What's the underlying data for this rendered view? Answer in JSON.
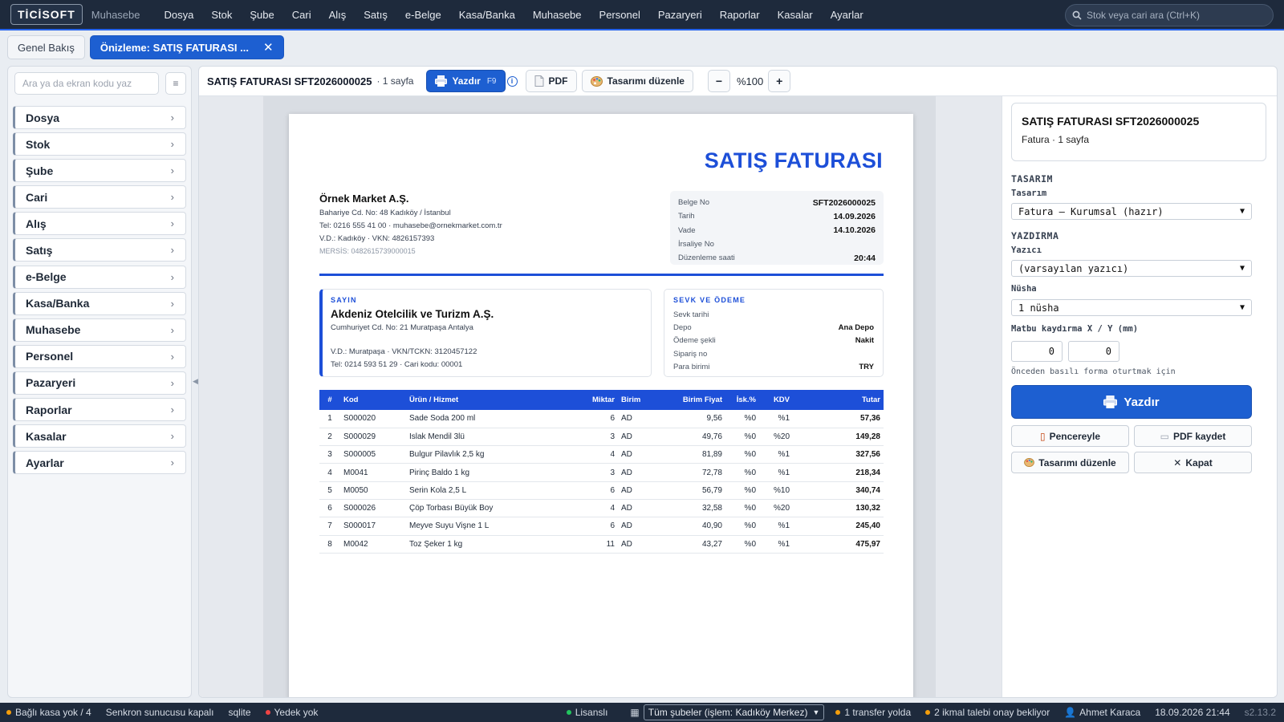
{
  "app": {
    "logo": "TİCİSOFT",
    "module": "Muhasebe"
  },
  "menu": [
    "Dosya",
    "Stok",
    "Şube",
    "Cari",
    "Alış",
    "Satış",
    "e-Belge",
    "Kasa/Banka",
    "Muhasebe",
    "Personel",
    "Pazaryeri",
    "Raporlar",
    "Kasalar",
    "Ayarlar"
  ],
  "search": {
    "placeholder": "Stok veya cari ara (Ctrl+K)"
  },
  "tabs": {
    "overview": "Genel Bakış",
    "active": "Önizleme: SATIŞ FATURASI ...",
    "close": "✕"
  },
  "sidebar": {
    "search_placeholder": "Ara ya da ekran kodu yaz",
    "items": [
      "Dosya",
      "Stok",
      "Şube",
      "Cari",
      "Alış",
      "Satış",
      "e-Belge",
      "Kasa/Banka",
      "Muhasebe",
      "Personel",
      "Pazaryeri",
      "Raporlar",
      "Kasalar",
      "Ayarlar"
    ]
  },
  "toolbar": {
    "title": "SATIŞ FATURASI SFT2026000025",
    "pages": "· 1 sayfa",
    "print": "Yazdır",
    "print_key": "F9",
    "pdf": "PDF",
    "edit_design": "Tasarımı düzenle",
    "zoom": "%100",
    "zoom_out": "−",
    "zoom_in": "+"
  },
  "invoice": {
    "title": "SATIŞ FATURASI",
    "seller": {
      "name": "Örnek Market A.Ş.",
      "address": "Bahariye Cd. No: 48 Kadıköy / İstanbul",
      "contact": "Tel: 0216 555 41 00   ·   muhasebe@ornekmarket.com.tr",
      "tax": "V.D.: Kadıköy   ·   VKN: 4826157393",
      "mersis": "MERSİS: 0482615739000015"
    },
    "doc": [
      {
        "k": "Belge No",
        "v": "SFT2026000025"
      },
      {
        "k": "Tarih",
        "v": "14.09.2026"
      },
      {
        "k": "Vade",
        "v": "14.10.2026"
      },
      {
        "k": "İrsaliye No",
        "v": ""
      },
      {
        "k": "Düzenleme saati",
        "v": "20:44"
      }
    ],
    "customer": {
      "head": "SAYIN",
      "name": "Akdeniz Otelcilik ve Turizm A.Ş.",
      "address": "Cumhuriyet Cd. No: 21 Muratpaşa Antalya",
      "tax": "V.D.: Muratpaşa   ·   VKN/TCKN: 3120457122",
      "contact": "Tel: 0214 593 51 29   ·   Cari kodu: 00001"
    },
    "shipping": {
      "head": "SEVK VE ÖDEME",
      "rows": [
        {
          "k": "Sevk tarihi",
          "v": ""
        },
        {
          "k": "Depo",
          "v": "Ana Depo"
        },
        {
          "k": "Ödeme şekli",
          "v": "Nakit"
        },
        {
          "k": "Sipariş no",
          "v": ""
        },
        {
          "k": "Para birimi",
          "v": "TRY"
        }
      ]
    },
    "columns": [
      "#",
      "Kod",
      "Ürün / Hizmet",
      "Miktar",
      "Birim",
      "Birim Fiyat",
      "İsk.%",
      "KDV",
      "Tutar"
    ],
    "rows": [
      [
        "1",
        "S000020",
        "Sade Soda 200 ml",
        "6",
        "AD",
        "9,56",
        "%0",
        "%1",
        "57,36"
      ],
      [
        "2",
        "S000029",
        "Islak Mendil 3lü",
        "3",
        "AD",
        "49,76",
        "%0",
        "%20",
        "149,28"
      ],
      [
        "3",
        "S000005",
        "Bulgur Pilavlık 2,5 kg",
        "4",
        "AD",
        "81,89",
        "%0",
        "%1",
        "327,56"
      ],
      [
        "4",
        "M0041",
        "Pirinç Baldo 1 kg",
        "3",
        "AD",
        "72,78",
        "%0",
        "%1",
        "218,34"
      ],
      [
        "5",
        "M0050",
        "Serin Kola 2,5 L",
        "6",
        "AD",
        "56,79",
        "%0",
        "%10",
        "340,74"
      ],
      [
        "6",
        "S000026",
        "Çöp Torbası Büyük Boy",
        "4",
        "AD",
        "32,58",
        "%0",
        "%20",
        "130,32"
      ],
      [
        "7",
        "S000017",
        "Meyve Suyu Vişne 1 L",
        "6",
        "AD",
        "40,90",
        "%0",
        "%1",
        "245,40"
      ],
      [
        "8",
        "M0042",
        "Toz Şeker 1 kg",
        "11",
        "AD",
        "43,27",
        "%0",
        "%1",
        "475,97"
      ]
    ]
  },
  "panel": {
    "title": "SATIŞ FATURASI SFT2026000025",
    "subtitle": "Fatura · 1 sayfa",
    "design_section": "TASARIM",
    "design_label": "Tasarım",
    "design_value": "Fatura — Kurumsal (hazır)",
    "print_section": "YAZDIRMA",
    "printer_label": "Yazıcı",
    "printer_value": "(varsayılan yazıcı)",
    "copies_label": "Nüsha",
    "copies_value": "1 nüsha",
    "offset_label": "Matbu kaydırma X / Y (mm)",
    "offset_x": "0",
    "offset_y": "0",
    "offset_hint": "Önceden basılı forma oturtmak için",
    "print_button": "Yazdır",
    "window_button": "Pencereyle",
    "pdf_button": "PDF kaydet",
    "design_button": "Tasarımı düzenle",
    "close_button": "Kapat"
  },
  "status": {
    "cash": "Bağlı kasa yok / 4",
    "sync": "Senkron sunucusu kapalı",
    "db": "sqlite",
    "backup": "Yedek yok",
    "license": "Lisanslı",
    "branch": "Tüm şubeler (işlem: Kadıköy Merkez)",
    "transfer": "1 transfer yolda",
    "supply": "2 ikmal talebi onay bekliyor",
    "user": "Ahmet Karaca",
    "datetime": "18.09.2026 21:44",
    "version": "s2.13.2"
  },
  "colors": {
    "accent": "#1d5fd1",
    "topbar": "#1e2a3c",
    "invoice_blue": "#1d4fd8",
    "dot_orange": "#f59e0b",
    "dot_red": "#ef4444",
    "dot_green": "#22c55e"
  }
}
